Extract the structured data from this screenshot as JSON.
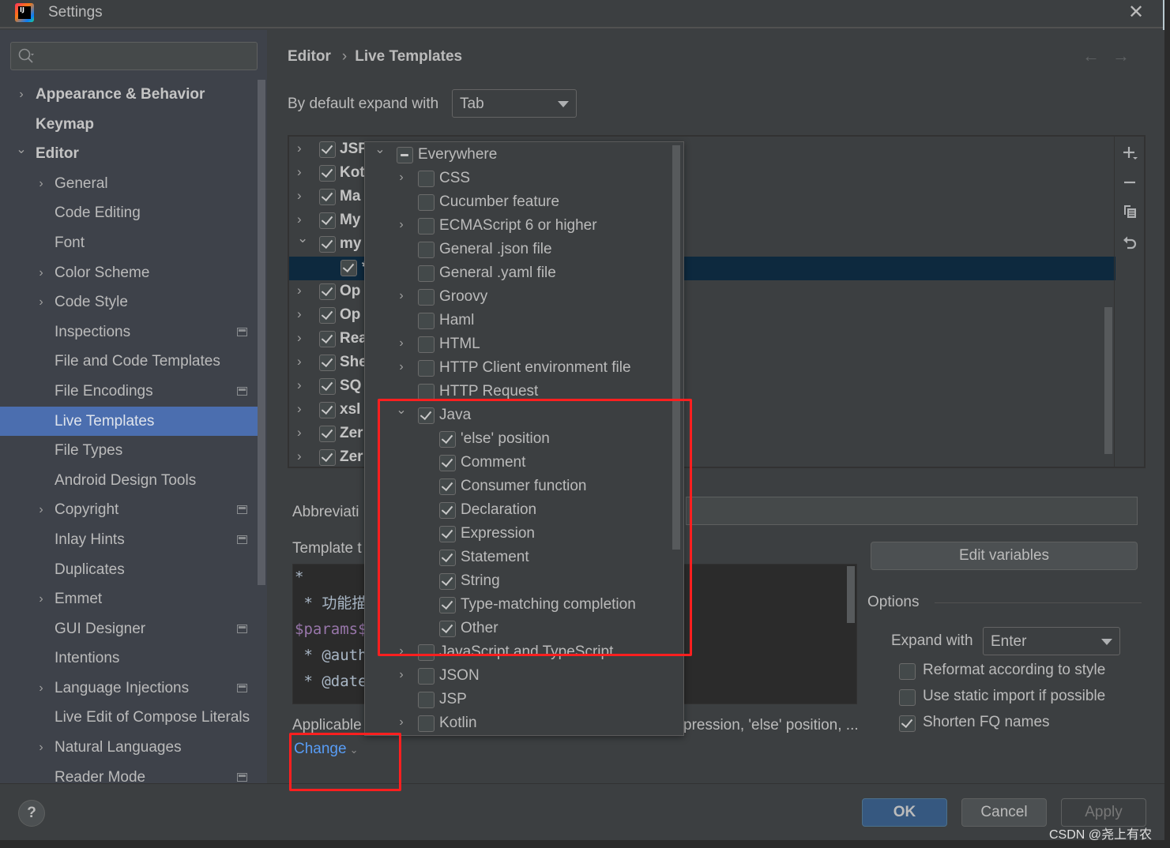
{
  "window": {
    "title": "Settings",
    "logo_text": "IJ",
    "close_glyph": "✕"
  },
  "sidebar": {
    "search_placeholder": "",
    "items": [
      {
        "label": "Appearance & Behavior",
        "level": 0,
        "chevron": "right",
        "project_icon": false
      },
      {
        "label": "Keymap",
        "level": 0,
        "chevron": "none",
        "project_icon": false
      },
      {
        "label": "Editor",
        "level": 0,
        "chevron": "down",
        "project_icon": false
      },
      {
        "label": "General",
        "level": 1,
        "chevron": "right",
        "project_icon": false
      },
      {
        "label": "Code Editing",
        "level": 1,
        "chevron": "none",
        "project_icon": false
      },
      {
        "label": "Font",
        "level": 1,
        "chevron": "none",
        "project_icon": false
      },
      {
        "label": "Color Scheme",
        "level": 1,
        "chevron": "right",
        "project_icon": false
      },
      {
        "label": "Code Style",
        "level": 1,
        "chevron": "right",
        "project_icon": false
      },
      {
        "label": "Inspections",
        "level": 1,
        "chevron": "none",
        "project_icon": true
      },
      {
        "label": "File and Code Templates",
        "level": 1,
        "chevron": "none",
        "project_icon": false
      },
      {
        "label": "File Encodings",
        "level": 1,
        "chevron": "none",
        "project_icon": true
      },
      {
        "label": "Live Templates",
        "level": 1,
        "chevron": "none",
        "project_icon": false,
        "selected": true
      },
      {
        "label": "File Types",
        "level": 1,
        "chevron": "none",
        "project_icon": false
      },
      {
        "label": "Android Design Tools",
        "level": 1,
        "chevron": "none",
        "project_icon": false
      },
      {
        "label": "Copyright",
        "level": 1,
        "chevron": "right",
        "project_icon": true
      },
      {
        "label": "Inlay Hints",
        "level": 1,
        "chevron": "none",
        "project_icon": true
      },
      {
        "label": "Duplicates",
        "level": 1,
        "chevron": "none",
        "project_icon": false
      },
      {
        "label": "Emmet",
        "level": 1,
        "chevron": "right",
        "project_icon": false
      },
      {
        "label": "GUI Designer",
        "level": 1,
        "chevron": "none",
        "project_icon": true
      },
      {
        "label": "Intentions",
        "level": 1,
        "chevron": "none",
        "project_icon": false
      },
      {
        "label": "Language Injections",
        "level": 1,
        "chevron": "right",
        "project_icon": true
      },
      {
        "label": "Live Edit of Compose Literals",
        "level": 1,
        "chevron": "none",
        "project_icon": false
      },
      {
        "label": "Natural Languages",
        "level": 1,
        "chevron": "right",
        "project_icon": false
      },
      {
        "label": "Reader Mode",
        "level": 1,
        "chevron": "none",
        "project_icon": true
      }
    ]
  },
  "breadcrumb": {
    "parent": "Editor",
    "separator": "›",
    "current": "Live Templates",
    "back_glyph": "←",
    "forward_glyph": "→"
  },
  "expand_default": {
    "label": "By default expand with",
    "value": "Tab"
  },
  "template_groups": [
    {
      "name": "JSP",
      "checked": true,
      "expanded": false
    },
    {
      "name": "Kot",
      "checked": true,
      "expanded": false
    },
    {
      "name": "Ma",
      "checked": true,
      "expanded": false
    },
    {
      "name": "My",
      "checked": true,
      "expanded": false
    },
    {
      "name": "my",
      "checked": true,
      "expanded": true
    },
    {
      "name": "*",
      "checked": true,
      "child": true,
      "selected": true
    },
    {
      "name": "Op",
      "checked": true,
      "expanded": false
    },
    {
      "name": "Op",
      "checked": true,
      "expanded": false
    },
    {
      "name": "Rea",
      "checked": true,
      "expanded": false
    },
    {
      "name": "She",
      "checked": true,
      "expanded": false
    },
    {
      "name": "SQ",
      "checked": true,
      "expanded": false
    },
    {
      "name": "xsl",
      "checked": true,
      "expanded": false
    },
    {
      "name": "Zer",
      "checked": true,
      "expanded": false
    },
    {
      "name": "Zer",
      "checked": true,
      "expanded": false
    }
  ],
  "toolbar": {
    "add_icon": "plus-dropdown",
    "remove_icon": "minus",
    "copy_icon": "copy",
    "restore_icon": "undo"
  },
  "abbreviation": {
    "label": "Abbreviati",
    "value": ""
  },
  "template_text": {
    "label": "Template t",
    "lines": [
      {
        "text": "*",
        "kind": "plain"
      },
      {
        "text": " * 功能描",
        "kind": "plain"
      },
      {
        "text": "$params$",
        "kind": "var"
      },
      {
        "text": " * @auth",
        "kind": "plain"
      },
      {
        "text": " * @date",
        "kind": "plain"
      },
      {
        "text": "   ",
        "kind": "plain"
      }
    ]
  },
  "edit_variables_label": "Edit variables",
  "options": {
    "title": "Options",
    "expand_with_label": "Expand with",
    "expand_with_value": "Enter",
    "checkboxes": [
      {
        "label": "Reformat according to style",
        "checked": false
      },
      {
        "label": "Use static import if possible",
        "checked": false
      },
      {
        "label": "Shorten FQ names",
        "checked": true
      }
    ]
  },
  "applicable": {
    "label": "Applicable",
    "value": "pression, 'else' position, ...",
    "change_label": "Change"
  },
  "context_popup": {
    "rows": [
      {
        "label": "Everywhere",
        "level": 0,
        "chevron": "down",
        "state": "partial"
      },
      {
        "label": "CSS",
        "level": 1,
        "chevron": "right",
        "state": "unchecked"
      },
      {
        "label": "Cucumber feature",
        "level": 1,
        "chevron": "none",
        "state": "unchecked"
      },
      {
        "label": "ECMAScript 6 or higher",
        "level": 1,
        "chevron": "right",
        "state": "unchecked"
      },
      {
        "label": "General .json file",
        "level": 1,
        "chevron": "none",
        "state": "unchecked"
      },
      {
        "label": "General .yaml file",
        "level": 1,
        "chevron": "none",
        "state": "unchecked"
      },
      {
        "label": "Groovy",
        "level": 1,
        "chevron": "right",
        "state": "unchecked"
      },
      {
        "label": "Haml",
        "level": 1,
        "chevron": "none",
        "state": "unchecked"
      },
      {
        "label": "HTML",
        "level": 1,
        "chevron": "right",
        "state": "unchecked"
      },
      {
        "label": "HTTP Client environment file",
        "level": 1,
        "chevron": "right",
        "state": "unchecked"
      },
      {
        "label": "HTTP Request",
        "level": 1,
        "chevron": "none",
        "state": "unchecked"
      },
      {
        "label": "Java",
        "level": 1,
        "chevron": "down",
        "state": "checked"
      },
      {
        "label": "'else' position",
        "level": 2,
        "chevron": "none",
        "state": "checked"
      },
      {
        "label": "Comment",
        "level": 2,
        "chevron": "none",
        "state": "checked"
      },
      {
        "label": "Consumer function",
        "level": 2,
        "chevron": "none",
        "state": "checked"
      },
      {
        "label": "Declaration",
        "level": 2,
        "chevron": "none",
        "state": "checked"
      },
      {
        "label": "Expression",
        "level": 2,
        "chevron": "none",
        "state": "checked"
      },
      {
        "label": "Statement",
        "level": 2,
        "chevron": "none",
        "state": "checked"
      },
      {
        "label": "String",
        "level": 2,
        "chevron": "none",
        "state": "checked"
      },
      {
        "label": "Type-matching completion",
        "level": 2,
        "chevron": "none",
        "state": "checked"
      },
      {
        "label": "Other",
        "level": 2,
        "chevron": "none",
        "state": "checked"
      },
      {
        "label": "JavaScript and TypeScript",
        "level": 1,
        "chevron": "right",
        "state": "unchecked"
      },
      {
        "label": "JSON",
        "level": 1,
        "chevron": "right",
        "state": "unchecked"
      },
      {
        "label": "JSP",
        "level": 1,
        "chevron": "none",
        "state": "unchecked"
      },
      {
        "label": "Kotlin",
        "level": 1,
        "chevron": "right",
        "state": "unchecked"
      }
    ]
  },
  "annotation_color": "#ff1f1f",
  "buttons": {
    "help": "?",
    "ok": "OK",
    "cancel": "Cancel",
    "apply": "Apply"
  },
  "watermark": "CSDN @尧上有农"
}
